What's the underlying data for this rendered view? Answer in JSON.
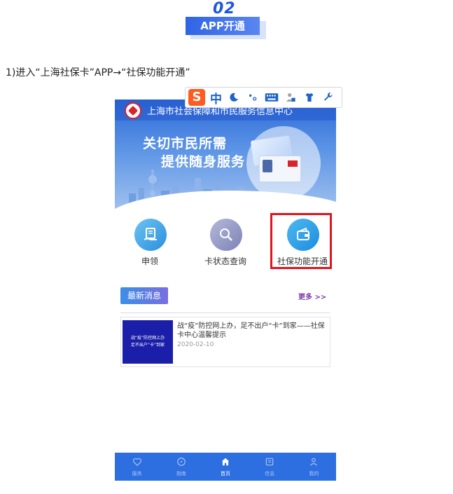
{
  "section": {
    "number": "02",
    "title": "APP开通"
  },
  "instruction": "1)进入“上海社保卡”APP→“社保功能开通”",
  "app": {
    "title": "上海市社会保障和市民服务信息中心",
    "slogan_line1": "关切市民所需",
    "slogan_line2": "提供随身服务",
    "features": [
      {
        "label": "申领",
        "icon": "document-hand-icon"
      },
      {
        "label": "卡状态查询",
        "icon": "search-icon"
      },
      {
        "label": "社保功能开通",
        "icon": "wallet-icon"
      }
    ],
    "news": {
      "tab_label": "最新消息",
      "more_label": "更多 >>",
      "items": [
        {
          "title": "战“疫”防控网上办，足不出户“卡”到家——社保卡中心温馨提示",
          "date": "2020-02-10",
          "thumb_line1": "战“疫”防控网上办",
          "thumb_line2": "足不出户“卡”到家"
        }
      ]
    },
    "bottom_nav": [
      {
        "label": "服务",
        "icon": "heart-icon"
      },
      {
        "label": "指南",
        "icon": "compass-icon"
      },
      {
        "label": "首页",
        "icon": "home-icon",
        "active": true
      },
      {
        "label": "信息",
        "icon": "news-icon"
      },
      {
        "label": "我的",
        "icon": "user-icon"
      }
    ]
  },
  "ime_toolbar": {
    "logo": "S",
    "mode": "中",
    "icons": [
      "moon-icon",
      "punctuation-icon",
      "keyboard-icon",
      "user-skin-icon",
      "shirt-icon",
      "wrench-icon"
    ]
  },
  "colors": {
    "accent_blue": "#2d6ee0",
    "highlight_red": "#e1141c",
    "logo_red": "#d8232a"
  }
}
